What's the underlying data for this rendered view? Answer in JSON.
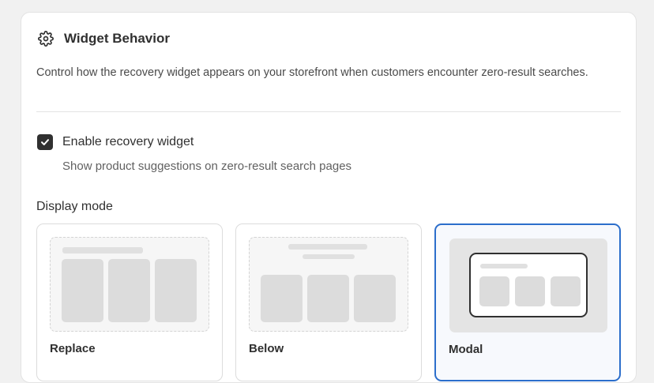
{
  "section": {
    "title": "Widget Behavior",
    "icon": "gear-icon",
    "description": "Control how the recovery widget appears on your storefront when customers encounter zero-result searches."
  },
  "enable_widget": {
    "label": "Enable recovery widget",
    "help_text": "Show product suggestions on zero-result search pages",
    "checked": true
  },
  "display_mode": {
    "label": "Display mode",
    "selected": "Modal",
    "options": [
      {
        "title": "Replace",
        "selected": false
      },
      {
        "title": "Below",
        "selected": false
      },
      {
        "title": "Modal",
        "selected": true
      }
    ]
  },
  "colors": {
    "accent": "#2c6ecb",
    "checkbox": "#303030"
  }
}
